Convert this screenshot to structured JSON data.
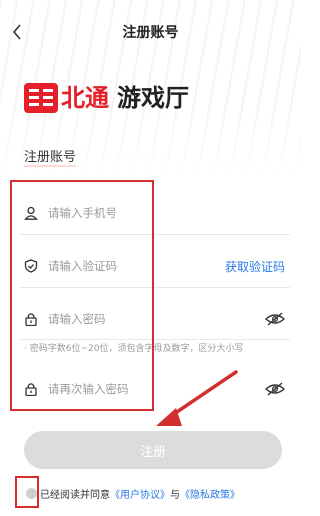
{
  "header": {
    "title": "注册账号",
    "back_icon": "chevron-left-icon"
  },
  "logo": {
    "brand_a": "北通",
    "brand_b": "游戏厅",
    "mark_icon": "betop-logo-mark",
    "brand_color": "#e5202a"
  },
  "section": {
    "title": "注册账号"
  },
  "form": {
    "phone": {
      "placeholder": "请输入手机号",
      "icon": "user-icon"
    },
    "code": {
      "placeholder": "请输入验证码",
      "icon": "shield-icon",
      "action_label": "获取验证码"
    },
    "password": {
      "placeholder": "请输入密码",
      "icon": "lock-icon",
      "toggle_icon": "eye-off-icon"
    },
    "password_hint": "· 密码字数6位~20位，须包含字母及数字，区分大小写",
    "confirm_password": {
      "placeholder": "请再次输入密码",
      "icon": "lock-icon",
      "toggle_icon": "eye-off-icon"
    }
  },
  "register_button": {
    "label": "注册"
  },
  "agreement": {
    "prefix": "已经阅读并同意",
    "user_agreement": "《用户协议》",
    "conjunction": "与",
    "privacy_policy": "《隐私政策》"
  },
  "colors": {
    "link": "#2a7ae4",
    "annotation": "#d32f2f",
    "button_disabled": "#dcdcdc"
  }
}
